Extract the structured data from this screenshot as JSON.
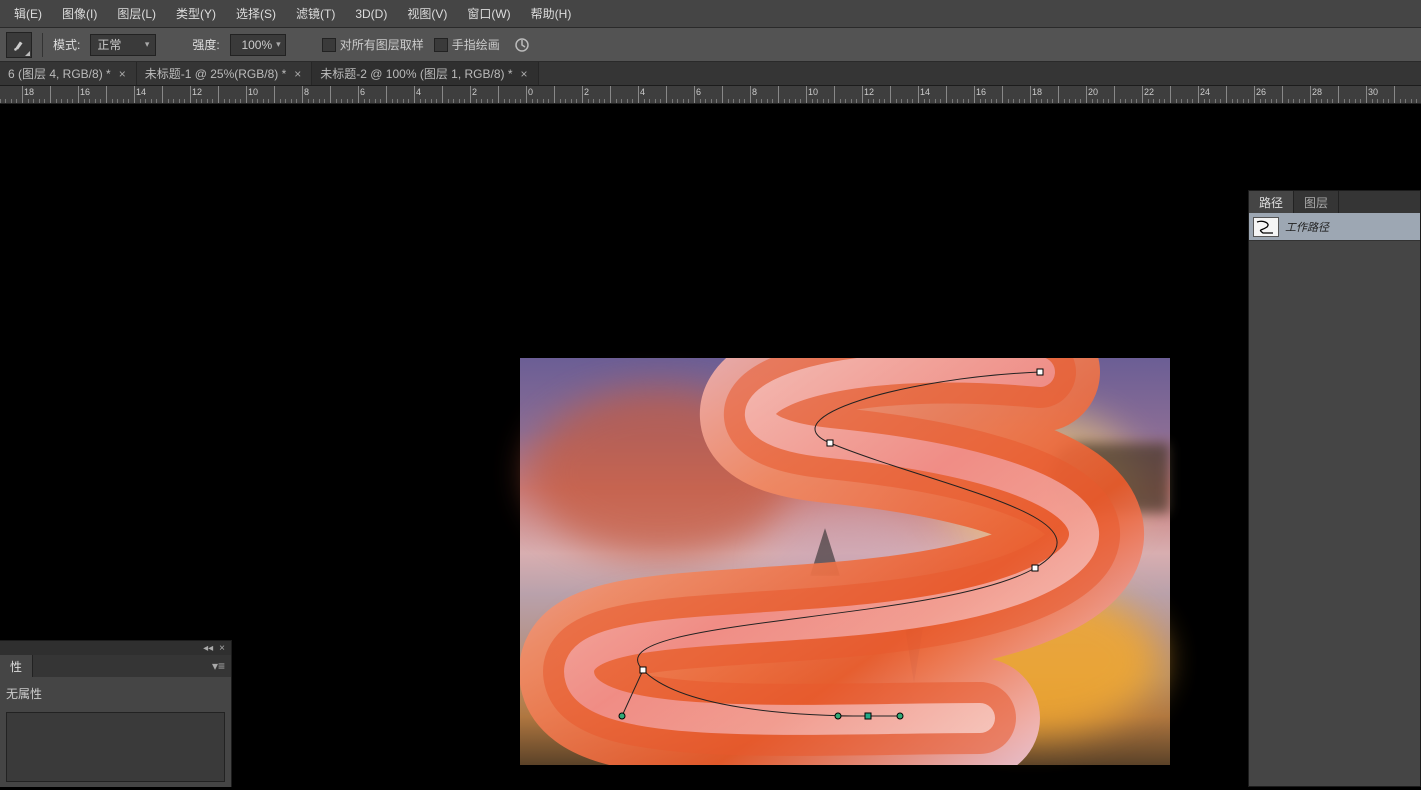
{
  "menu": {
    "items": [
      "辑(E)",
      "图像(I)",
      "图层(L)",
      "类型(Y)",
      "选择(S)",
      "滤镜(T)",
      "3D(D)",
      "视图(V)",
      "窗口(W)",
      "帮助(H)"
    ]
  },
  "options": {
    "mode_label": "模式:",
    "mode_value": "正常",
    "strength_label": "强度:",
    "strength_value": "100%",
    "sample_all_layers": "对所有图层取样",
    "finger_painting": "手指绘画"
  },
  "tabs": {
    "items": [
      {
        "label": "6 (图层 4, RGB/8) *",
        "active": false
      },
      {
        "label": "未标题-1 @ 25%(RGB/8) *",
        "active": false
      },
      {
        "label": "未标题-2 @ 100% (图层 1, RGB/8) *",
        "active": true
      }
    ]
  },
  "ruler": {
    "start": 16,
    "step": 2,
    "count": 27
  },
  "paths_panel": {
    "tabs": [
      "路径",
      "图层"
    ],
    "active_row": "工作路径"
  },
  "props_panel": {
    "tab": "性",
    "title": "无属性"
  }
}
